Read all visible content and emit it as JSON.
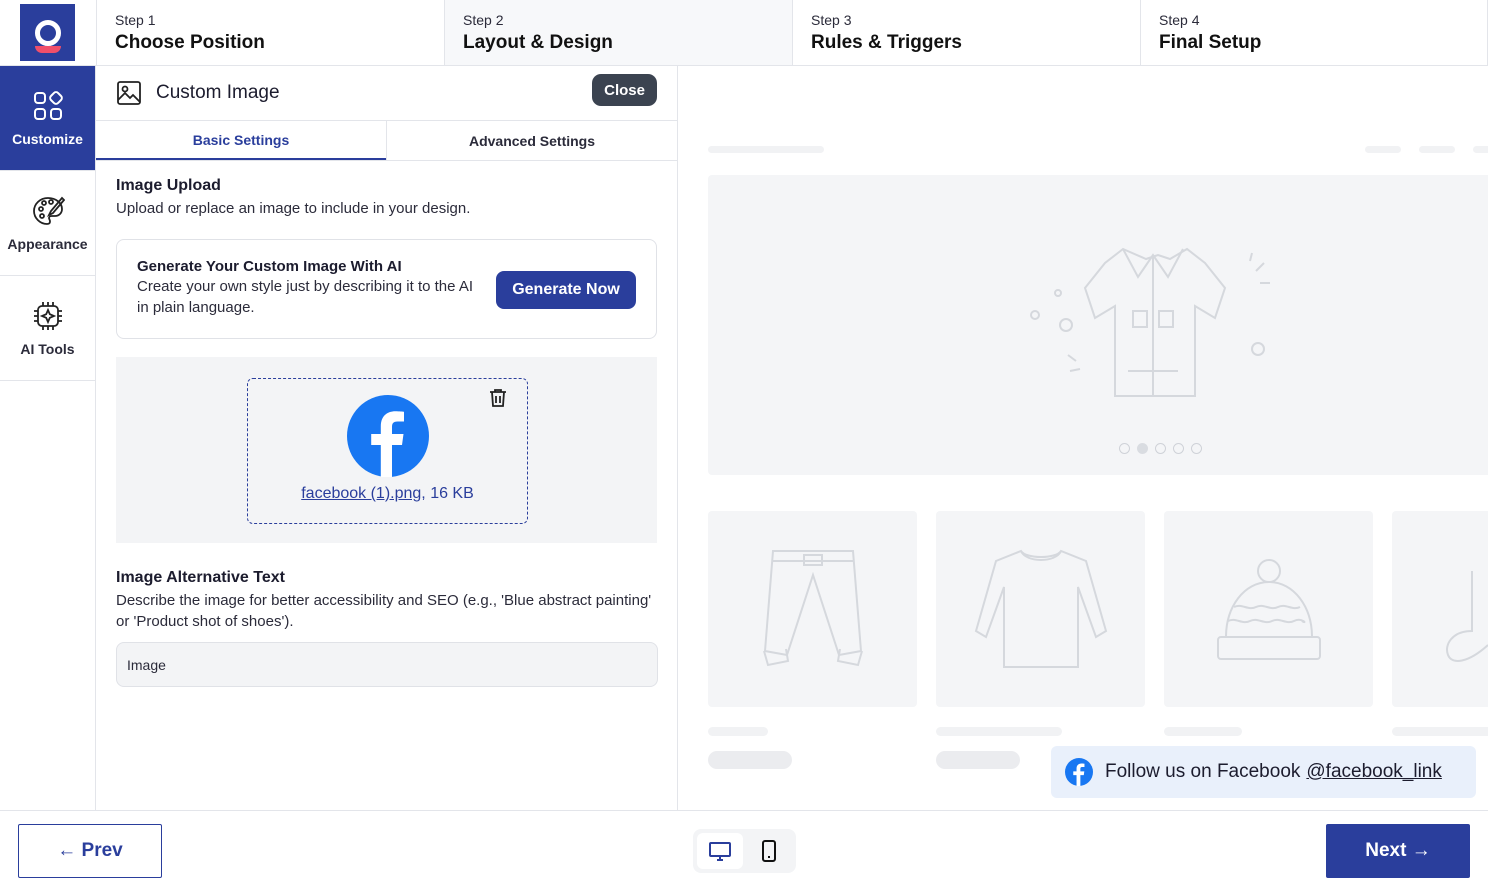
{
  "steps": [
    {
      "num": "Step 1",
      "title": "Choose Position"
    },
    {
      "num": "Step 2",
      "title": "Layout & Design"
    },
    {
      "num": "Step 3",
      "title": "Rules & Triggers"
    },
    {
      "num": "Step 4",
      "title": "Final Setup"
    }
  ],
  "sidebar": {
    "items": [
      {
        "label": "Customize",
        "icon": "grid-icon",
        "active": true
      },
      {
        "label": "Appearance",
        "icon": "palette-icon",
        "active": false
      },
      {
        "label": "AI Tools",
        "icon": "chip-icon",
        "active": false
      }
    ]
  },
  "panel": {
    "title": "Custom Image",
    "close_label": "Close",
    "tabs": [
      {
        "label": "Basic Settings",
        "active": true
      },
      {
        "label": "Advanced Settings",
        "active": false
      }
    ],
    "upload": {
      "title": "Image Upload",
      "desc": "Upload or replace an image to include in your design."
    },
    "ai": {
      "title": "Generate Your Custom Image With AI",
      "desc": "Create your own style just by describing it to the AI in plain language.",
      "button": "Generate Now"
    },
    "file": {
      "name": "facebook (1).png",
      "size": ", 16 KB"
    },
    "alt": {
      "title": "Image Alternative Text",
      "desc": "Describe the image for better accessibility and SEO (e.g., 'Blue abstract painting' or 'Product shot of shoes').",
      "value": "Image"
    }
  },
  "preview": {
    "banner_text": "Follow us on Facebook",
    "banner_link": "@facebook_link"
  },
  "nav": {
    "prev": "← Prev",
    "next": "Next →"
  },
  "colors": {
    "brand": "#2a3e9c",
    "facebook": "#1877f2",
    "close_button": "#3b4350"
  }
}
